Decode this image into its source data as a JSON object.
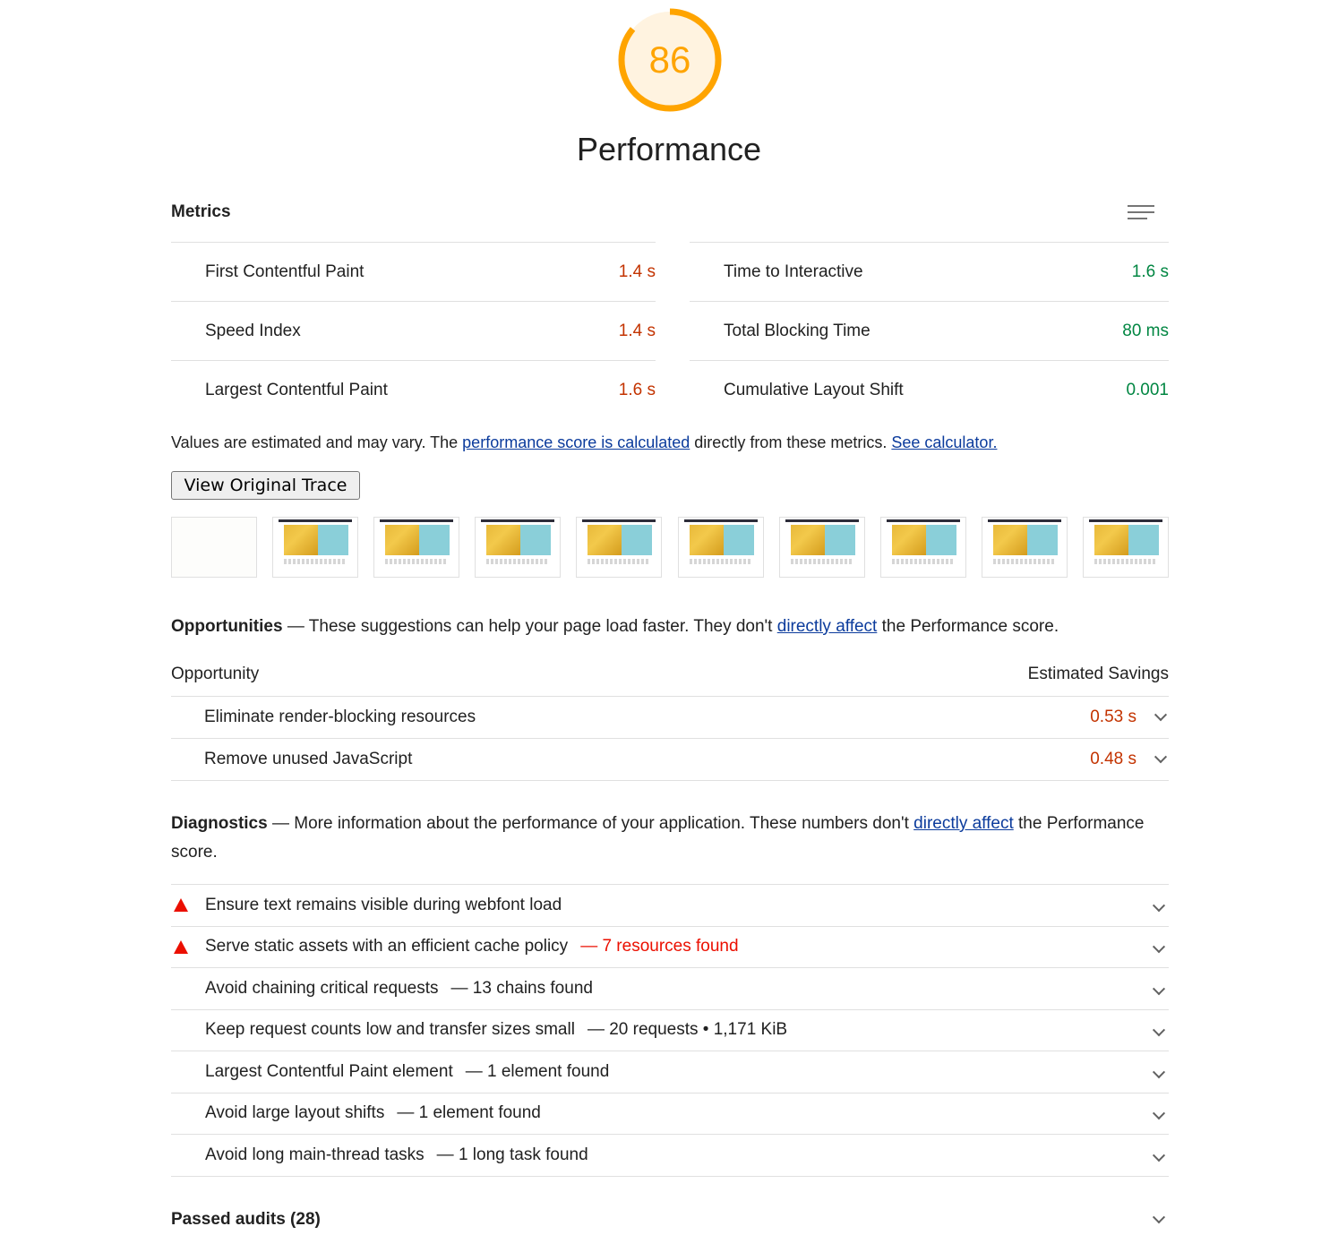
{
  "score": {
    "value": "86",
    "fraction": 0.86,
    "color": "#ffa400"
  },
  "category_title": "Performance",
  "metrics": {
    "title": "Metrics",
    "items": [
      {
        "label": "First Contentful Paint",
        "value": "1.4 s",
        "status": "average"
      },
      {
        "label": "Time to Interactive",
        "value": "1.6 s",
        "status": "pass"
      },
      {
        "label": "Speed Index",
        "value": "1.4 s",
        "status": "average"
      },
      {
        "label": "Total Blocking Time",
        "value": "80 ms",
        "status": "pass"
      },
      {
        "label": "Largest Contentful Paint",
        "value": "1.6 s",
        "status": "average"
      },
      {
        "label": "Cumulative Layout Shift",
        "value": "0.001",
        "status": "pass"
      }
    ]
  },
  "disclaimer": {
    "text1": "Values are estimated and may vary. The ",
    "link1": "performance score is calculated",
    "text2": " directly from these metrics.",
    "link2": "See calculator."
  },
  "trace_button": "View Original Trace",
  "opportunities": {
    "title": "Opportunities",
    "dash": " — ",
    "desc1": "These suggestions can help your page load faster. They don't ",
    "link": "directly affect",
    "desc2": " the Performance score.",
    "col_left": "Opportunity",
    "col_right": "Estimated Savings",
    "items": [
      {
        "label": "Eliminate render-blocking resources",
        "value": "0.53 s"
      },
      {
        "label": "Remove unused JavaScript",
        "value": "0.48 s"
      }
    ]
  },
  "diagnostics": {
    "title": "Diagnostics",
    "dash": " — ",
    "desc1": "More information about the performance of your application. These numbers don't ",
    "link": "directly affect",
    "desc2": " the Performance score.",
    "items": [
      {
        "label": "Ensure text remains visible during webfont load",
        "detail": "",
        "status": "fail"
      },
      {
        "label": "Serve static assets with an efficient cache policy",
        "detail": "— 7 resources found",
        "status": "fail"
      },
      {
        "label": "Avoid chaining critical requests",
        "detail": "— 13 chains found",
        "status": "info"
      },
      {
        "label": "Keep request counts low and transfer sizes small",
        "detail": "— 20 requests • 1,171 KiB",
        "status": "info"
      },
      {
        "label": "Largest Contentful Paint element",
        "detail": "— 1 element found",
        "status": "info"
      },
      {
        "label": "Avoid large layout shifts",
        "detail": "— 1 element found",
        "status": "info"
      },
      {
        "label": "Avoid long main-thread tasks",
        "detail": "— 1 long task found",
        "status": "info"
      }
    ]
  },
  "passed_audits": "Passed audits (28)",
  "colors": {
    "average": "#c33300",
    "pass": "#018642",
    "fail": "#eb0f00",
    "link": "#0b3b9c"
  }
}
